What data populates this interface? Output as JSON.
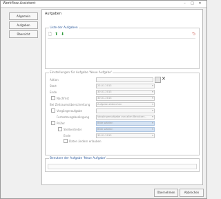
{
  "window": {
    "title": "Workflow-Assistent",
    "controls": {
      "minimize": "–",
      "maximize": "□",
      "close": "✕"
    }
  },
  "nav": [
    {
      "label": "Allgemein"
    },
    {
      "label": "Aufgaben"
    },
    {
      "label": "Übersicht"
    }
  ],
  "panel": {
    "title": "Aufgaben",
    "task_list": {
      "legend": "Liste der Aufgaben",
      "toolbar": {
        "new": "🗋",
        "up": "⬆",
        "down": "⬇",
        "help": "⮌"
      }
    },
    "settings": {
      "legend": "Einstellungen für Aufgabe 'Neue Aufgabe'",
      "fields": {
        "aktion": {
          "label": "Aktion",
          "value": ""
        },
        "start": {
          "label": "Start",
          "value": "23.01.2013"
        },
        "ende": {
          "label": "Ende",
          "value": "30.01.2013"
        },
        "nachfrist": {
          "label": "Nachfrist",
          "value": "30.01.2013"
        },
        "zeitraum": {
          "label": "Bei Zeitraumsüberschreitung",
          "value": "Aufgabe abbrechen"
        },
        "vorgaenger": {
          "label": "Vorgängeraufgabe",
          "value": ""
        },
        "fortsetzung": {
          "label": "Fortsetzungsbedingung",
          "value": "Vorgängeraufgabe von allen Benutzer..."
        },
        "pruefer": {
          "label": "Prüfer",
          "value": "Bitte wählen"
        },
        "stellvertreter": {
          "label": "Stellvertreter",
          "value": "Bitte wählen"
        },
        "ende2": {
          "label": "Ende",
          "value": "30.01.2013"
        },
        "aendern": {
          "label": "Daten ändern erlauben"
        }
      }
    },
    "notes": {
      "legend": "Benutzer der Aufgabe 'Neue Aufgabe'"
    }
  },
  "buttons": {
    "ok": "Übernehmen",
    "cancel": "Abbrechen"
  }
}
